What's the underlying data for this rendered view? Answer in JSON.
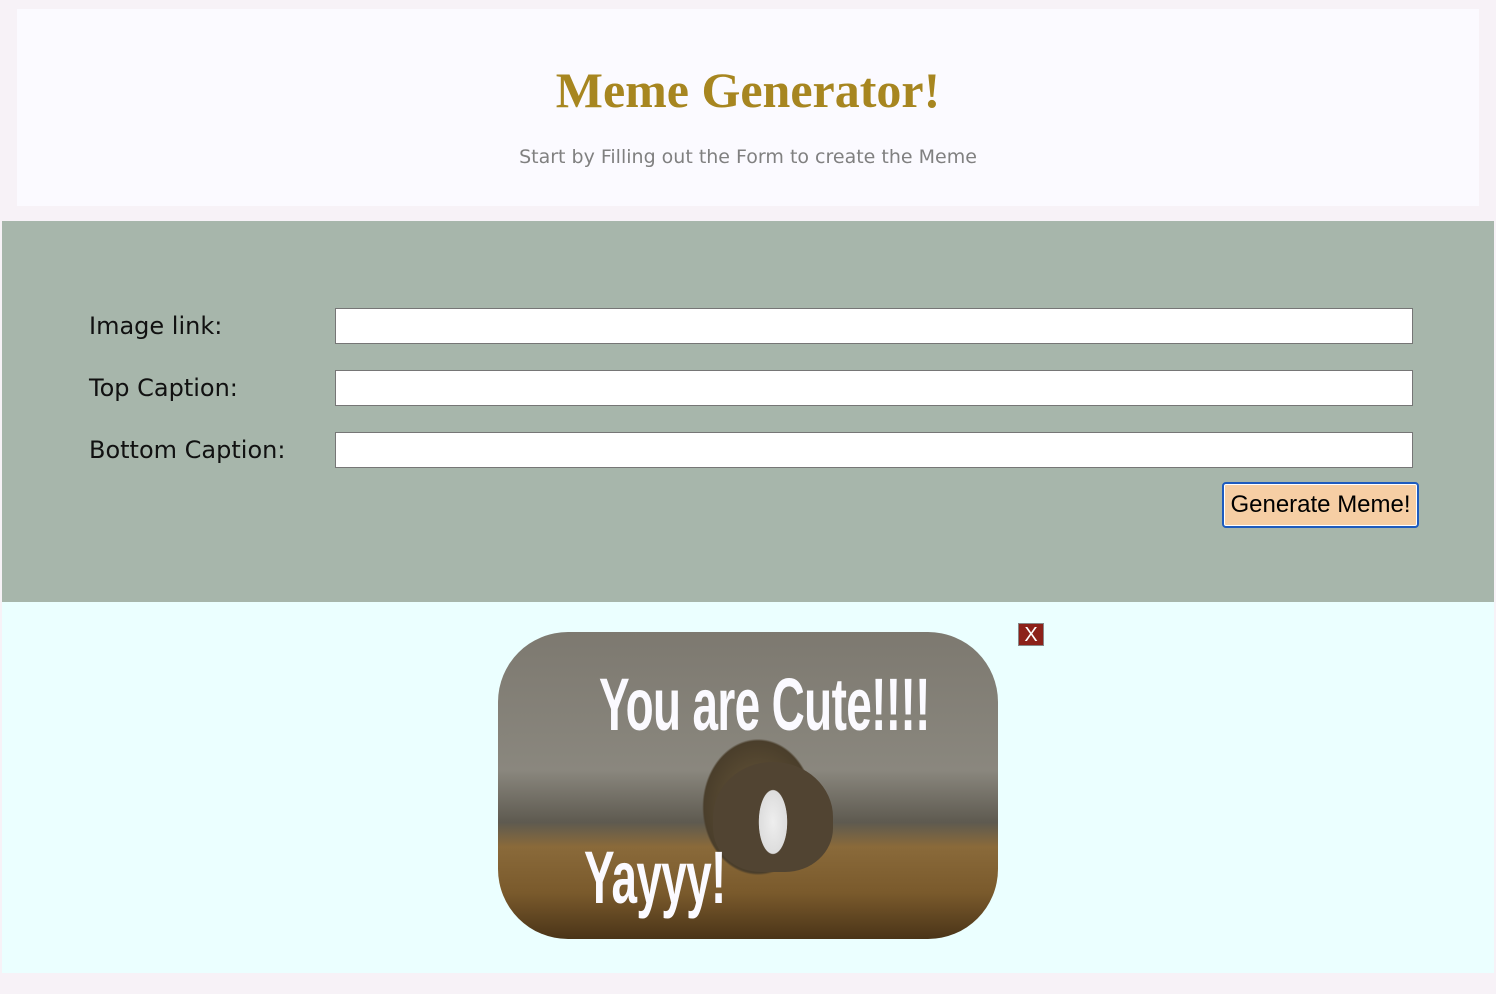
{
  "header": {
    "title": "Meme Generator!",
    "subtitle": "Start by Filling out the Form to create the Meme"
  },
  "form": {
    "fields": [
      {
        "label": "Image link:",
        "value": ""
      },
      {
        "label": "Top Caption:",
        "value": ""
      },
      {
        "label": "Bottom Caption:",
        "value": ""
      }
    ],
    "submit_label": "Generate Meme!"
  },
  "memes": [
    {
      "top_caption": "You are Cute!!!!",
      "bottom_caption": "Yayyy!",
      "close_label": "X"
    }
  ],
  "colors": {
    "title": "#a78620",
    "form_bg": "#a7b6ab",
    "result_bg": "#ebffff",
    "button": "#f6cea4",
    "close": "#8c2119"
  }
}
